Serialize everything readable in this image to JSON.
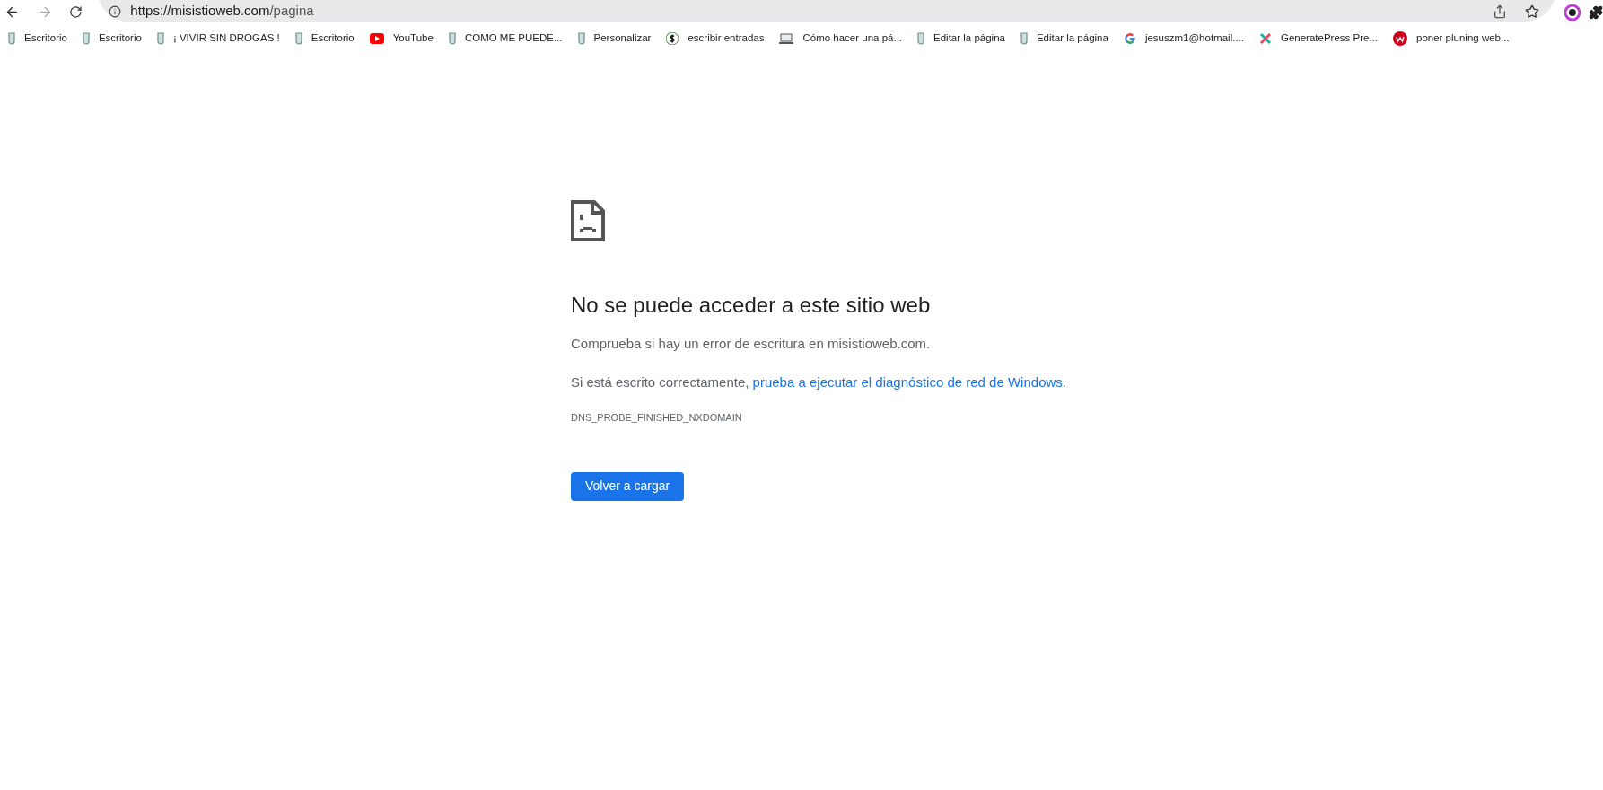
{
  "toolbar": {
    "url_host": "https://misistioweb.com",
    "url_path": "/pagina"
  },
  "bookmarks": [
    {
      "kind": "flask",
      "label": "Escritorio"
    },
    {
      "kind": "flask",
      "label": "Escritorio"
    },
    {
      "kind": "flask",
      "label": "¡ VIVIR SIN DROGAS !"
    },
    {
      "kind": "flask",
      "label": "Escritorio"
    },
    {
      "kind": "video",
      "label": "YouTube"
    },
    {
      "kind": "flask",
      "label": "COMO ME PUEDE..."
    },
    {
      "kind": "flask",
      "label": "Personalizar"
    },
    {
      "kind": "dollar",
      "label": "escribir entradas"
    },
    {
      "kind": "laptop",
      "label": "Cómo hacer una pá..."
    },
    {
      "kind": "flask",
      "label": "Editar la página"
    },
    {
      "kind": "flask",
      "label": "Editar la página"
    },
    {
      "kind": "g",
      "label": "jesuszm1@hotmail...."
    },
    {
      "kind": "x",
      "label": "GeneratePress Pre..."
    },
    {
      "kind": "w",
      "label": "poner pluning web..."
    }
  ],
  "error": {
    "title": "No se puede acceder a este sitio web",
    "check": "Comprueba si hay un error de escritura en misistioweb.com.",
    "hint": "Si está escrito correctamente, ",
    "hint_link": "prueba a ejecutar el diagnóstico de red de Windows",
    "hint_end": ".",
    "code": "DNS_PROBE_FINISHED_NXDOMAIN",
    "button": "Volver a cargar"
  }
}
